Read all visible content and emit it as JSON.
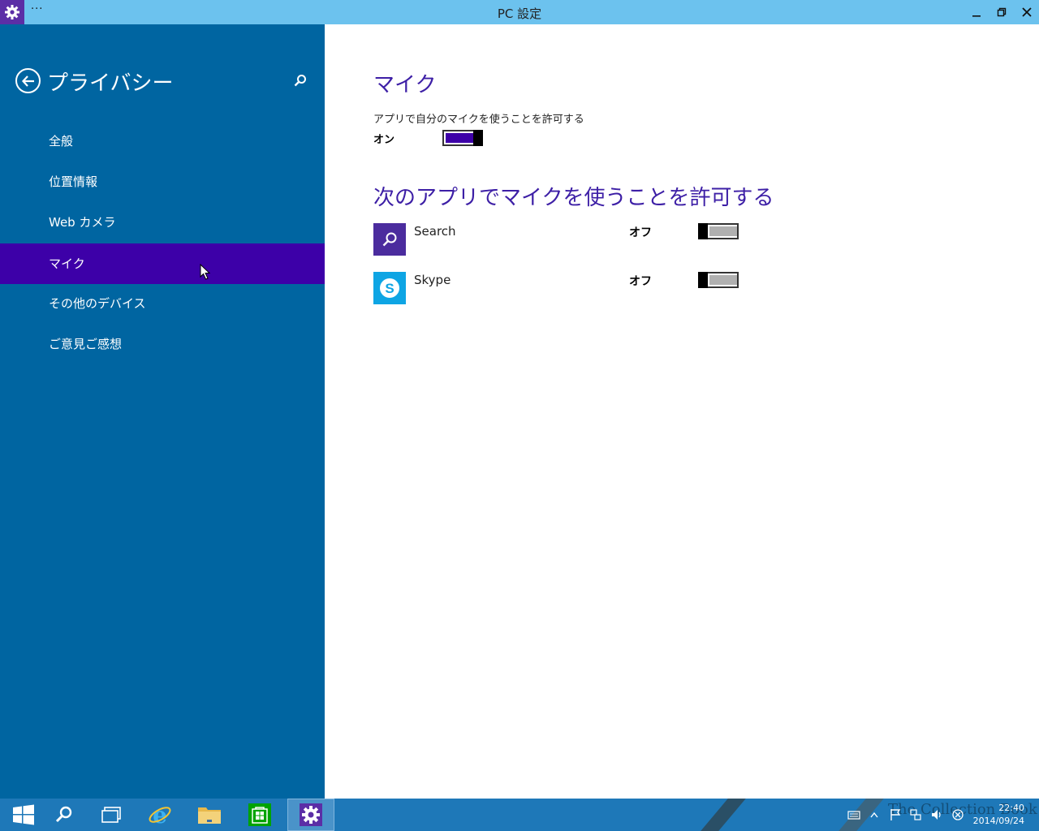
{
  "window": {
    "title": "PC 設定",
    "menu": "···",
    "minimize": "–",
    "restore": "❐",
    "close": "✕"
  },
  "sidebar": {
    "title": "プライバシー",
    "items": [
      {
        "label": "全般"
      },
      {
        "label": "位置情報"
      },
      {
        "label": "Web カメラ"
      },
      {
        "label": "マイク"
      },
      {
        "label": "その他のデバイス"
      },
      {
        "label": "ご意見ご感想"
      }
    ],
    "selected_index": 3
  },
  "main": {
    "heading": "マイク",
    "description": "アプリで自分のマイクを使うことを許可する",
    "master_state": "オン",
    "master_on": true,
    "apps_heading": "次のアプリでマイクを使うことを許可する",
    "apps": [
      {
        "name": "Search",
        "state": "オフ",
        "on": false
      },
      {
        "name": "Skype",
        "state": "オフ",
        "on": false
      }
    ]
  },
  "colors": {
    "accent": "#3d00a8",
    "sidebar": "#0065a1",
    "titlebar": "#6cc2ee",
    "taskbar": "#1e78b8"
  },
  "taskbar": {
    "watermark": "The Collection Book",
    "time": "22:40",
    "date": "2014/09/24"
  }
}
